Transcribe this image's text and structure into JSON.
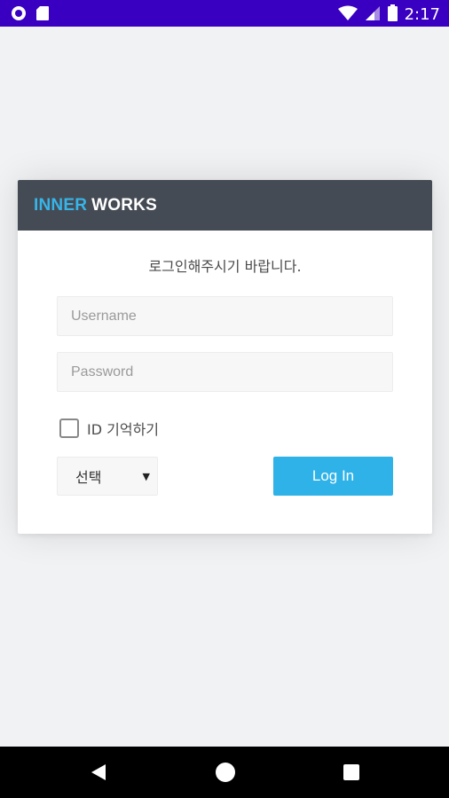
{
  "status_bar": {
    "time": "2:17",
    "icons": [
      "circle-notification-icon",
      "sd-card-icon",
      "wifi-icon",
      "signal-icon",
      "battery-icon"
    ]
  },
  "brand": {
    "part1": "INNER",
    "part2": "WORKS"
  },
  "login": {
    "prompt": "로그인해주시기 바랍니다.",
    "username_placeholder": "Username",
    "password_placeholder": "Password",
    "remember_label": "ID 기억하기",
    "select_value": "선택",
    "login_button": "Log In"
  },
  "colors": {
    "status_bar": "#3a00c2",
    "header": "#454b54",
    "brand_accent": "#37b4e8",
    "button": "#2fb2e8"
  },
  "nav": {
    "icons": [
      "back-icon",
      "home-icon",
      "recents-icon"
    ]
  }
}
